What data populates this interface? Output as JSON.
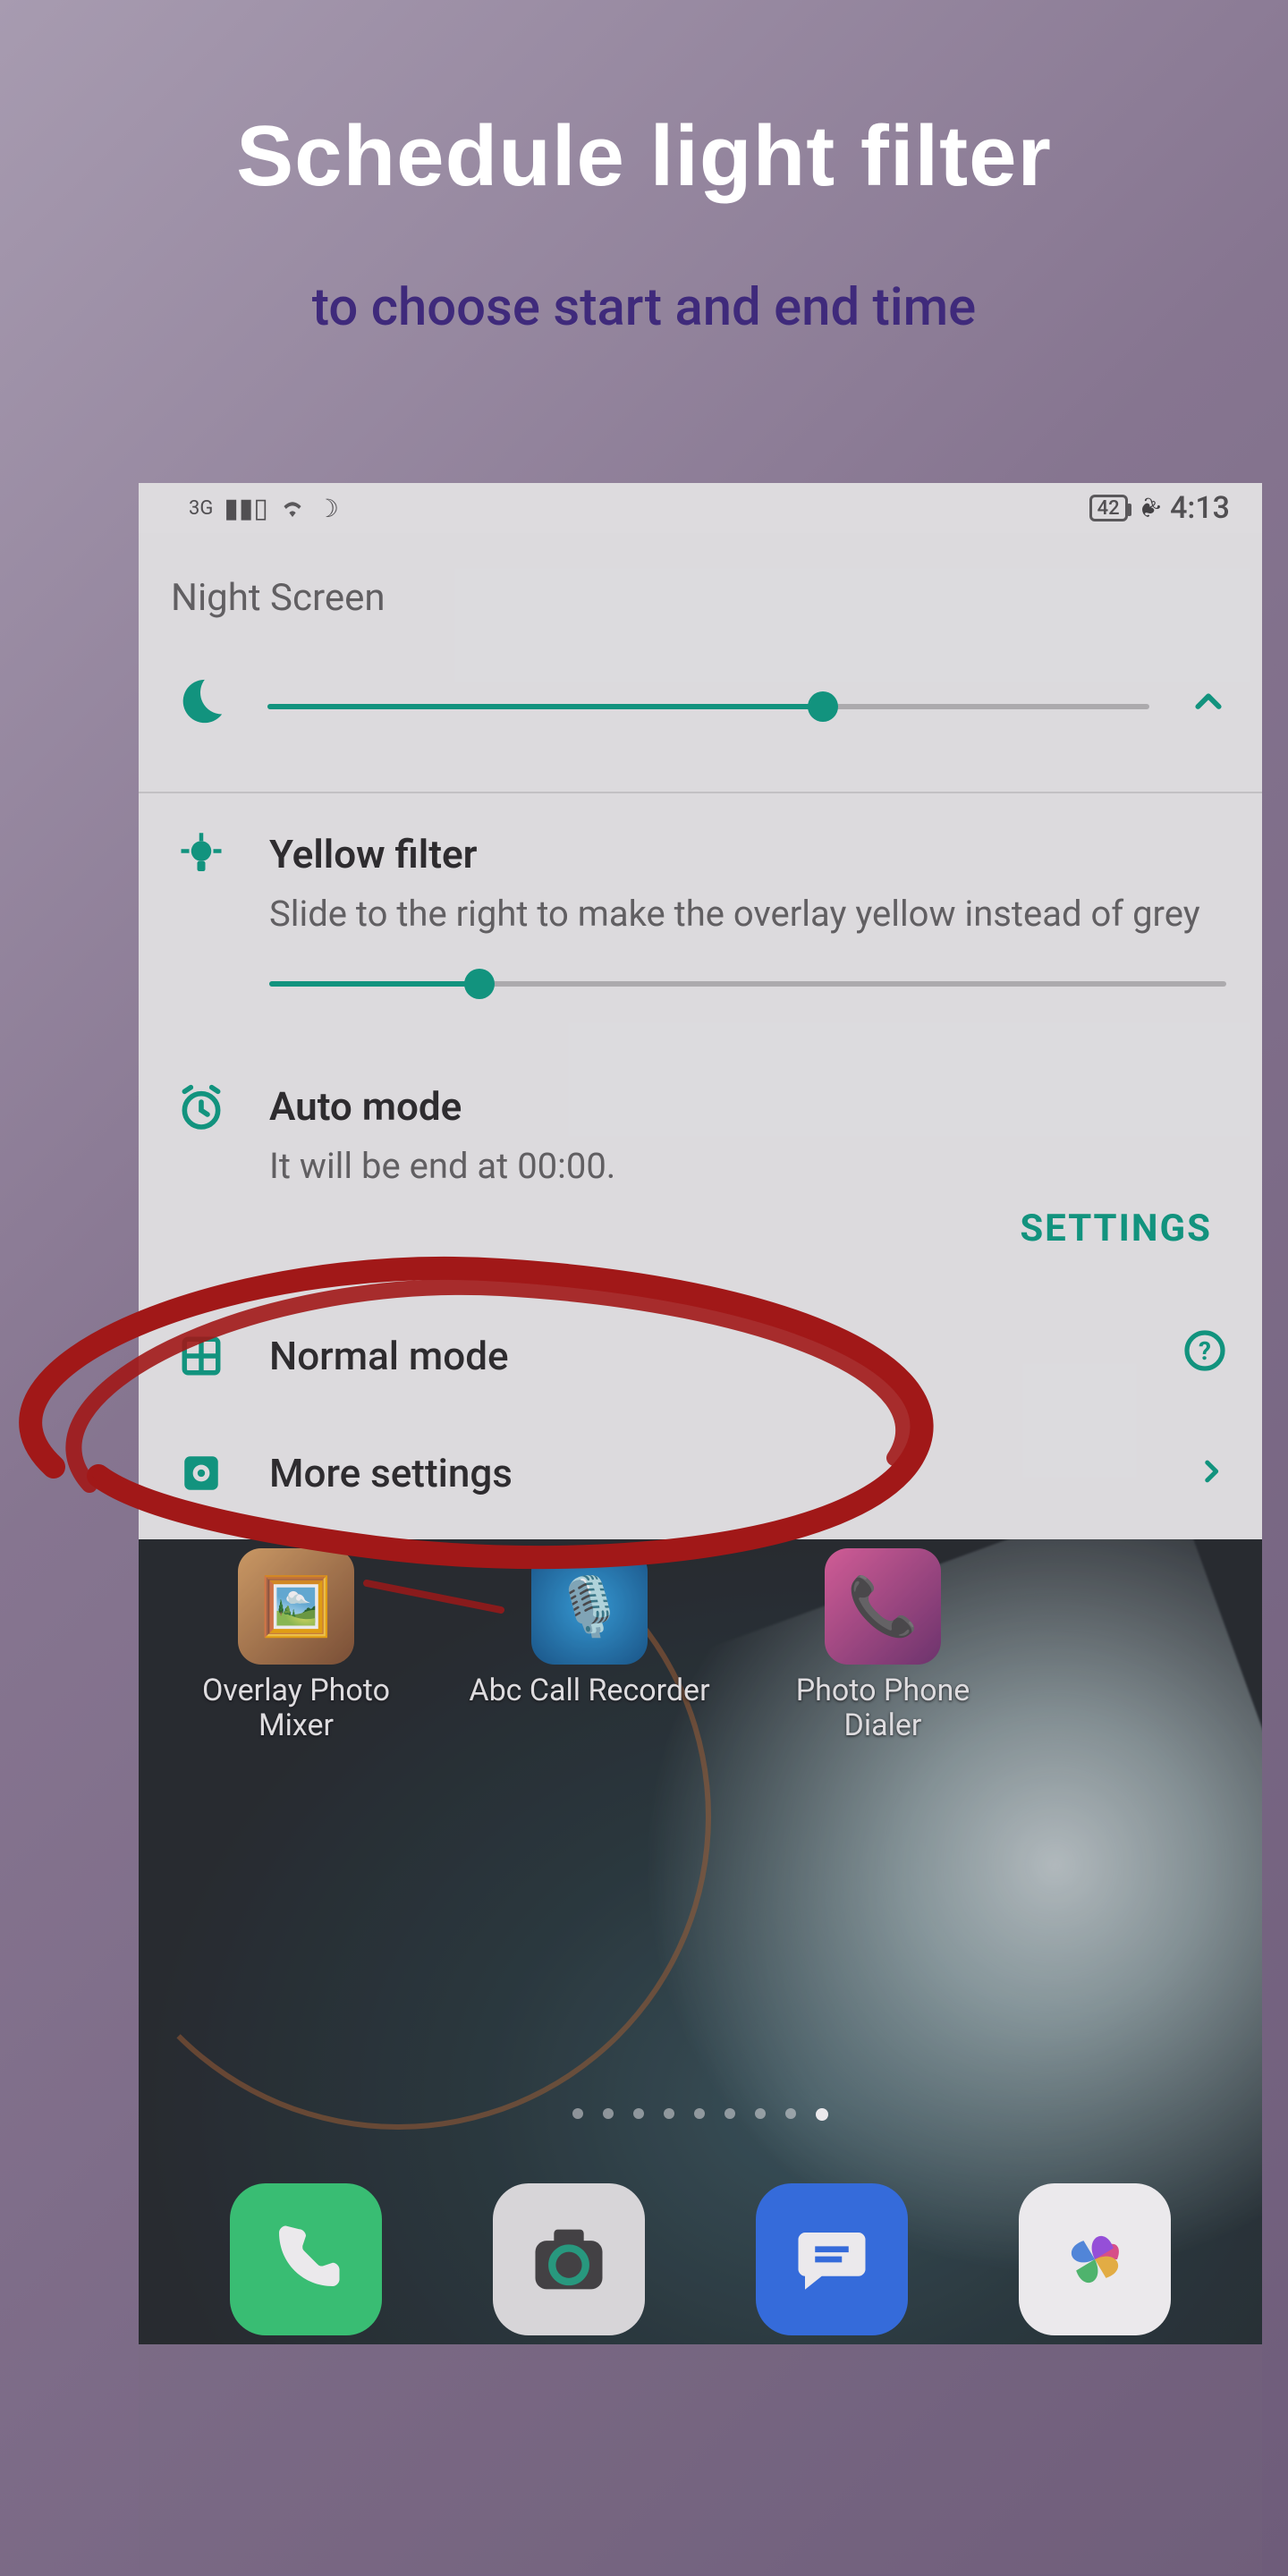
{
  "promo": {
    "heading": "Schedule light filter",
    "subheading": "to choose start and end time"
  },
  "status": {
    "network": "3G",
    "battery": "42",
    "time": "4:13"
  },
  "app": {
    "title": "Night Screen",
    "brightness_percent": 63,
    "yellow": {
      "title": "Yellow filter",
      "desc": "Slide to the right to make the overlay yellow instead of grey",
      "percent": 22
    },
    "auto": {
      "title": "Auto mode",
      "desc": "It will be end at 00:00.",
      "settings_label": "SETTINGS"
    },
    "normal": {
      "title": "Normal mode"
    },
    "more": {
      "title": "More settings"
    }
  },
  "home": {
    "apps": [
      {
        "label": "Overlay Photo Mixer"
      },
      {
        "label": "Abc Call Recorder"
      },
      {
        "label": "Photo Phone Dialer"
      }
    ]
  }
}
